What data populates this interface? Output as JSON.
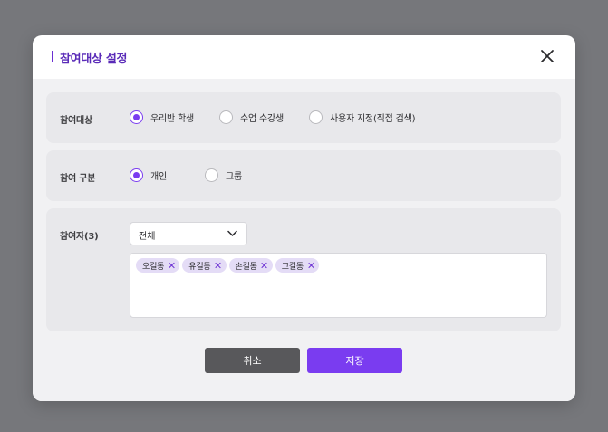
{
  "dialog": {
    "title": "참여대상 설정"
  },
  "target": {
    "label": "참여대상",
    "options": [
      "우리반 학생",
      "수업 수강생",
      "사용자 지정(직접 검색)"
    ],
    "selected": "우리반 학생"
  },
  "division": {
    "label": "참여 구분",
    "options": [
      "개인",
      "그룹"
    ],
    "selected": "개인"
  },
  "participants": {
    "label": "참여자(3)",
    "filter_value": "전체",
    "tags": [
      "오길동",
      "유길동",
      "손길동",
      "고길동"
    ]
  },
  "buttons": {
    "cancel": "취소",
    "save": "저장"
  },
  "colors": {
    "accent": "#7a3cf0",
    "title": "#5a2bb8",
    "cancel": "#58585b",
    "tag_bg": "#e4dcf6"
  }
}
